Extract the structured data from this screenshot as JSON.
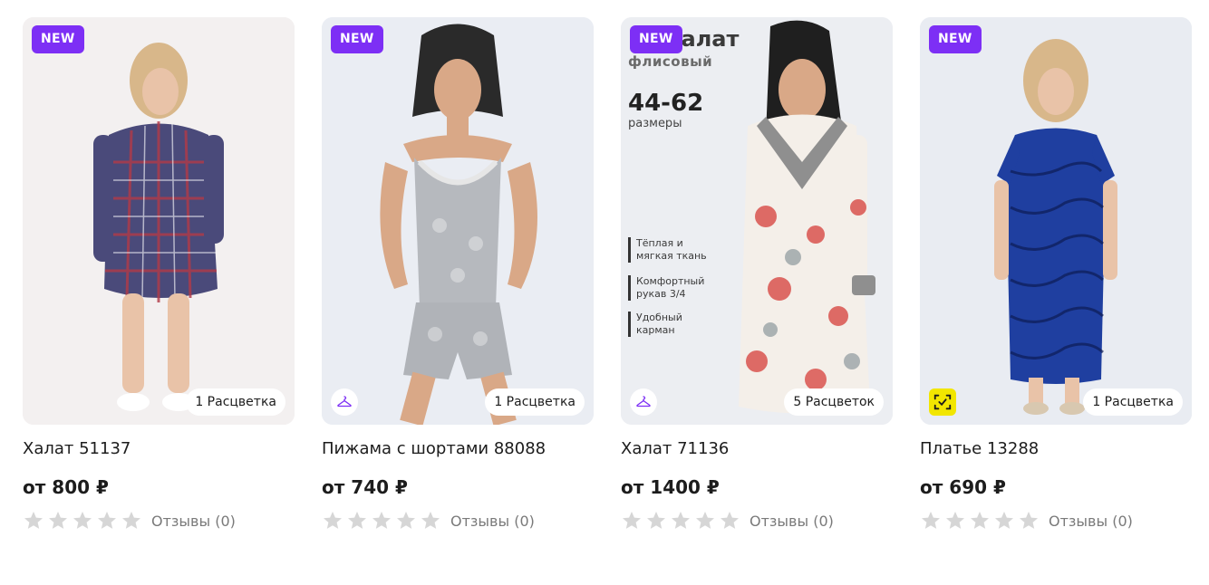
{
  "products": [
    {
      "badge": "NEW",
      "title": "Халат 51137",
      "price": "от 800 ₽",
      "colors": "1 Расцветка",
      "reviews": "Отзывы (0)",
      "rating": 0,
      "corner_icon": "none"
    },
    {
      "badge": "NEW",
      "title": "Пижама с шортами 88088",
      "price": "от 740 ₽",
      "colors": "1 Расцветка",
      "reviews": "Отзывы (0)",
      "rating": 0,
      "corner_icon": "hanger-icon"
    },
    {
      "badge": "NEW",
      "title": "Халат 71136",
      "price": "от 1400 ₽",
      "colors": "5 Расцветок",
      "reviews": "Отзывы (0)",
      "rating": 0,
      "corner_icon": "hanger-icon",
      "promo": {
        "line1": "Халат",
        "line2": "флисовый",
        "sizes": "44-62",
        "sizes_label": "размеры",
        "features": [
          [
            "Тёплая и",
            "мягкая ткань"
          ],
          [
            "Комфортный",
            "рукав 3/4"
          ],
          [
            "Удобный",
            "карман"
          ]
        ]
      }
    },
    {
      "badge": "NEW",
      "title": "Платье 13288",
      "price": "от 690 ₽",
      "colors": "1 Расцветка",
      "reviews": "Отзывы (0)",
      "rating": 0,
      "corner_icon": "scan-icon"
    }
  ],
  "colors": {
    "badge": "#7d2ff5",
    "star_empty": "#d6d6d6",
    "scan_badge": "#f2e600"
  }
}
